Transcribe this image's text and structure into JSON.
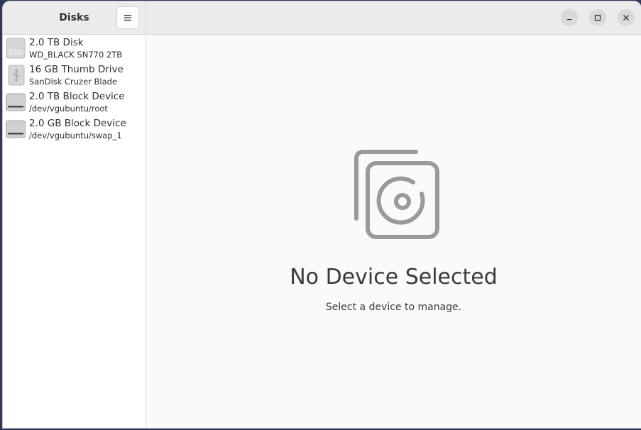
{
  "app": {
    "title": "Disks"
  },
  "sidebar": {
    "menu_icon": "hamburger-menu-icon",
    "devices": [
      {
        "name": "2.0 TB Disk",
        "subtitle": "WD_BLACK SN770 2TB",
        "icon": "ssd-icon",
        "icon_label": "SSD"
      },
      {
        "name": "16 GB Thumb Drive",
        "subtitle": "SanDisk Cruzer Blade",
        "icon": "usb-drive-icon"
      },
      {
        "name": "2.0 TB Block Device",
        "subtitle": "/dev/vgubuntu/root",
        "icon": "block-device-icon"
      },
      {
        "name": "2.0 GB Block Device",
        "subtitle": "/dev/vgubuntu/swap_1",
        "icon": "block-device-icon"
      }
    ]
  },
  "window_controls": {
    "minimize_icon": "minimize-icon",
    "maximize_icon": "maximize-icon",
    "close_icon": "close-icon"
  },
  "main": {
    "empty_state": {
      "icon": "disk-placeholder-icon",
      "title": "No Device Selected",
      "subtitle": "Select a device to manage."
    }
  }
}
